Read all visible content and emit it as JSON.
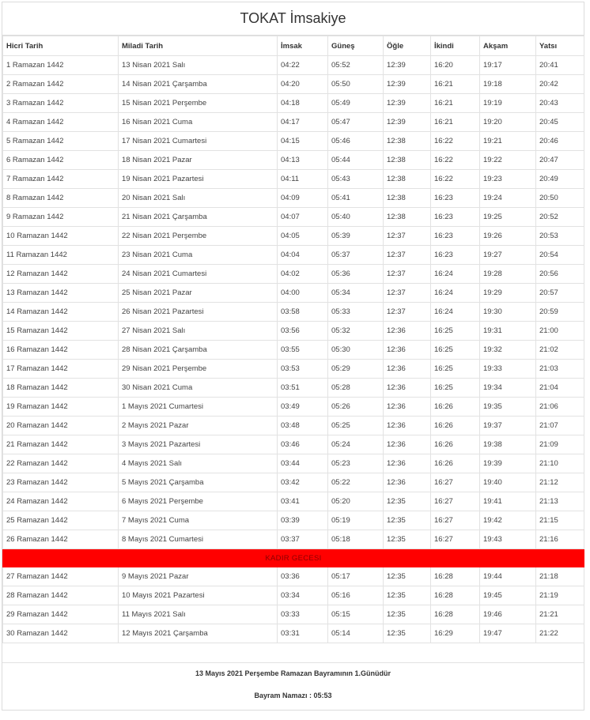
{
  "title": "TOKAT İmsakiye",
  "headers": [
    "Hicri Tarih",
    "Miladi Tarih",
    "İmsak",
    "Güneş",
    "Öğle",
    "İkindi",
    "Akşam",
    "Yatsı"
  ],
  "rows_before": [
    [
      "1 Ramazan 1442",
      "13 Nisan 2021 Salı",
      "04:22",
      "05:52",
      "12:39",
      "16:20",
      "19:17",
      "20:41"
    ],
    [
      "2 Ramazan 1442",
      "14 Nisan 2021 Çarşamba",
      "04:20",
      "05:50",
      "12:39",
      "16:21",
      "19:18",
      "20:42"
    ],
    [
      "3 Ramazan 1442",
      "15 Nisan 2021 Perşembe",
      "04:18",
      "05:49",
      "12:39",
      "16:21",
      "19:19",
      "20:43"
    ],
    [
      "4 Ramazan 1442",
      "16 Nisan 2021 Cuma",
      "04:17",
      "05:47",
      "12:39",
      "16:21",
      "19:20",
      "20:45"
    ],
    [
      "5 Ramazan 1442",
      "17 Nisan 2021 Cumartesi",
      "04:15",
      "05:46",
      "12:38",
      "16:22",
      "19:21",
      "20:46"
    ],
    [
      "6 Ramazan 1442",
      "18 Nisan 2021 Pazar",
      "04:13",
      "05:44",
      "12:38",
      "16:22",
      "19:22",
      "20:47"
    ],
    [
      "7 Ramazan 1442",
      "19 Nisan 2021 Pazartesi",
      "04:11",
      "05:43",
      "12:38",
      "16:22",
      "19:23",
      "20:49"
    ],
    [
      "8 Ramazan 1442",
      "20 Nisan 2021 Salı",
      "04:09",
      "05:41",
      "12:38",
      "16:23",
      "19:24",
      "20:50"
    ],
    [
      "9 Ramazan 1442",
      "21 Nisan 2021 Çarşamba",
      "04:07",
      "05:40",
      "12:38",
      "16:23",
      "19:25",
      "20:52"
    ],
    [
      "10 Ramazan 1442",
      "22 Nisan 2021 Perşembe",
      "04:05",
      "05:39",
      "12:37",
      "16:23",
      "19:26",
      "20:53"
    ],
    [
      "11 Ramazan 1442",
      "23 Nisan 2021 Cuma",
      "04:04",
      "05:37",
      "12:37",
      "16:23",
      "19:27",
      "20:54"
    ],
    [
      "12 Ramazan 1442",
      "24 Nisan 2021 Cumartesi",
      "04:02",
      "05:36",
      "12:37",
      "16:24",
      "19:28",
      "20:56"
    ],
    [
      "13 Ramazan 1442",
      "25 Nisan 2021 Pazar",
      "04:00",
      "05:34",
      "12:37",
      "16:24",
      "19:29",
      "20:57"
    ],
    [
      "14 Ramazan 1442",
      "26 Nisan 2021 Pazartesi",
      "03:58",
      "05:33",
      "12:37",
      "16:24",
      "19:30",
      "20:59"
    ],
    [
      "15 Ramazan 1442",
      "27 Nisan 2021 Salı",
      "03:56",
      "05:32",
      "12:36",
      "16:25",
      "19:31",
      "21:00"
    ],
    [
      "16 Ramazan 1442",
      "28 Nisan 2021 Çarşamba",
      "03:55",
      "05:30",
      "12:36",
      "16:25",
      "19:32",
      "21:02"
    ],
    [
      "17 Ramazan 1442",
      "29 Nisan 2021 Perşembe",
      "03:53",
      "05:29",
      "12:36",
      "16:25",
      "19:33",
      "21:03"
    ],
    [
      "18 Ramazan 1442",
      "30 Nisan 2021 Cuma",
      "03:51",
      "05:28",
      "12:36",
      "16:25",
      "19:34",
      "21:04"
    ],
    [
      "19 Ramazan 1442",
      "1 Mayıs 2021 Cumartesi",
      "03:49",
      "05:26",
      "12:36",
      "16:26",
      "19:35",
      "21:06"
    ],
    [
      "20 Ramazan 1442",
      "2 Mayıs 2021 Pazar",
      "03:48",
      "05:25",
      "12:36",
      "16:26",
      "19:37",
      "21:07"
    ],
    [
      "21 Ramazan 1442",
      "3 Mayıs 2021 Pazartesi",
      "03:46",
      "05:24",
      "12:36",
      "16:26",
      "19:38",
      "21:09"
    ],
    [
      "22 Ramazan 1442",
      "4 Mayıs 2021 Salı",
      "03:44",
      "05:23",
      "12:36",
      "16:26",
      "19:39",
      "21:10"
    ],
    [
      "23 Ramazan 1442",
      "5 Mayıs 2021 Çarşamba",
      "03:42",
      "05:22",
      "12:36",
      "16:27",
      "19:40",
      "21:12"
    ],
    [
      "24 Ramazan 1442",
      "6 Mayıs 2021 Perşembe",
      "03:41",
      "05:20",
      "12:35",
      "16:27",
      "19:41",
      "21:13"
    ],
    [
      "25 Ramazan 1442",
      "7 Mayıs 2021 Cuma",
      "03:39",
      "05:19",
      "12:35",
      "16:27",
      "19:42",
      "21:15"
    ],
    [
      "26 Ramazan 1442",
      "8 Mayıs 2021 Cumartesi",
      "03:37",
      "05:18",
      "12:35",
      "16:27",
      "19:43",
      "21:16"
    ]
  ],
  "kadir_label": "KADIR GECESI",
  "rows_after": [
    [
      "27 Ramazan 1442",
      "9 Mayıs 2021 Pazar",
      "03:36",
      "05:17",
      "12:35",
      "16:28",
      "19:44",
      "21:18"
    ],
    [
      "28 Ramazan 1442",
      "10 Mayıs 2021 Pazartesi",
      "03:34",
      "05:16",
      "12:35",
      "16:28",
      "19:45",
      "21:19"
    ],
    [
      "29 Ramazan 1442",
      "11 Mayıs 2021 Salı",
      "03:33",
      "05:15",
      "12:35",
      "16:28",
      "19:46",
      "21:21"
    ],
    [
      "30 Ramazan 1442",
      "12 Mayıs 2021 Çarşamba",
      "03:31",
      "05:14",
      "12:35",
      "16:29",
      "19:47",
      "21:22"
    ]
  ],
  "footer_line1": "13 Mayıs 2021 Perşembe Ramazan Bayramının 1.Günüdür",
  "footer_line2": "Bayram Namazı : 05:53",
  "colors": {
    "kadir_bg": "#ff0000",
    "kadir_text": "#8b0000",
    "border": "#e2e2e2"
  }
}
